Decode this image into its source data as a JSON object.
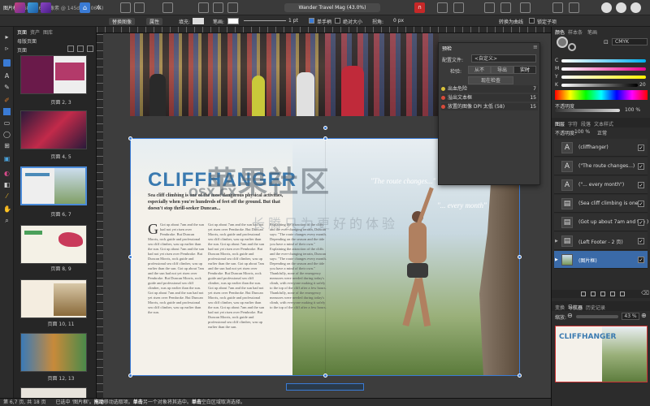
{
  "toolbar": {
    "persona_label": "图片框",
    "doc_info": "2688x1600 像素 @ 145dpi (206%)",
    "title": "Wander Travel Mag (43.0%)"
  },
  "context": {
    "replace_image": "替换图像",
    "properties": "属性",
    "fill": "填充:",
    "stroke": "笔画:",
    "stroke_width": "1 pt",
    "single": "单手柄",
    "absolute": "绝对大小",
    "corner": "拐角:",
    "corner_val": "0 px",
    "convert": "转换为曲线",
    "lock": "锁定子项"
  },
  "pages_panel": {
    "tab_pages": "页面",
    "tab_assets": "资产",
    "tab_stock": "图库",
    "master_section": "母版页面",
    "pages_section": "页面",
    "pages": [
      "页面 2, 3",
      "页面 4, 5",
      "页面 6, 7",
      "页面 8, 9",
      "页面 10, 11",
      "页面 12, 13"
    ]
  },
  "spread": {
    "title": "CLIFFHANGER",
    "subhead": "Sea cliff climbing is one of the most dangerous physical activities, especially when you're hundreds of feet off the ground. But that doesn't stop thrill-seeker Duncan...",
    "quote1": "\"The route changes...\"",
    "quote2": "\"... every month\"",
    "col1": "Got up about 7am and the sun had not yet risen over Pembroke. But Duncan Morris, rock guide and professional sea cliff climber, was up earlier than the sun.",
    "col2": "Explaining the attraction of the cliffs and the ever-changing terrain, Duncan says: \"The route changes every month. Depending on the season and the tide you have a mind of their own.\"",
    "col3": "Thankfully, none of the emergency measures were needed during today's climb, with everyone making it safely to the top of the cliff after a few hours."
  },
  "watermark": {
    "main": "苹果社区",
    "domain": "OSX.CX",
    "sub": "长腾只为更好的体验"
  },
  "preflight": {
    "title": "预检",
    "profile_label": "配置文件:",
    "profile_value": "<自定义>",
    "check_label": "检验:",
    "btn_never": "从不",
    "btn_export": "导出",
    "btn_live": "实时",
    "btn_check_now": "现在检查",
    "rows": [
      {
        "label": "出血危险",
        "count": "7",
        "color": "#d9c23a"
      },
      {
        "label": "溢出文本框",
        "count": "15",
        "color": "#d94b3a"
      },
      {
        "label": "放置的图像 DPI 太低 (58)",
        "count": "15",
        "color": "#d94b3a"
      }
    ]
  },
  "right_panel": {
    "tab_color": "颜色",
    "tab_swatches": "样本条",
    "tab_stroke": "笔画",
    "color_mode": "CMYK",
    "c_label": "C",
    "m_label": "M",
    "y_label": "Y",
    "k_label": "K",
    "k_value": "20",
    "opacity_label": "不透明度",
    "opacity_value": "100 %",
    "layers_tab": "图层",
    "char_tab": "字符",
    "para_tab": "段落",
    "textstyle_tab": "文本样式",
    "layer_opacity_label": "不透明度:",
    "layer_opacity": "100 %",
    "blend": "正常",
    "layers": [
      {
        "label": "(cliffhanger)",
        "icon": "A"
      },
      {
        "label": "(\"The route changes...)",
        "icon": "A"
      },
      {
        "label": "(\"... every month\")",
        "icon": "A"
      },
      {
        "label": "(Sea cliff climbing is one)",
        "icon": "▤"
      },
      {
        "label": "(Got up about 7am and the )",
        "icon": "▤"
      },
      {
        "label": "(Left Footer - 2 页)",
        "icon": "▤"
      },
      {
        "label": "(图片框)",
        "icon": "▣"
      }
    ],
    "nav_tab_transform": "变换",
    "nav_tab_navigator": "导航器",
    "nav_tab_history": "历史记录",
    "zoom_label": "缩放:",
    "zoom_value": "43 %"
  },
  "status": {
    "page": "第 6,7 页, 共 18 页",
    "hint1": "已选中 '图片框'。",
    "drag": "拖动",
    "hint2": "移动选取项。",
    "click": "单击",
    "hint3": "另一个对象将其选中。",
    "click2": "单击",
    "hint4": "空白区域取消选择。"
  }
}
